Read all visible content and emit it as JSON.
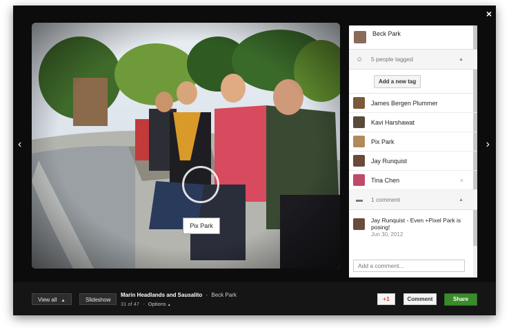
{
  "window": {
    "close_glyph": "×"
  },
  "nav": {
    "prev_glyph": "‹",
    "next_glyph": "›"
  },
  "photo": {
    "tag_label": "Pix Park"
  },
  "panel": {
    "owner_name": "Beck Park",
    "tagged_header": "5 people tagged",
    "add_tag_label": "Add a new tag",
    "people": [
      {
        "name": "James Bergen Plummer",
        "color": "#7a5a3a"
      },
      {
        "name": "Kavi Harshawat",
        "color": "#5a4a3a"
      },
      {
        "name": "Pix Park",
        "color": "#b08a5a"
      },
      {
        "name": "Jay Runquist",
        "color": "#6a4a3a"
      },
      {
        "name": "Tina Chen",
        "color": "#c04a6a"
      }
    ],
    "remove_glyph": "×",
    "comments_header": "1 comment",
    "comment": {
      "text": "Jay Runquist - Even +Pixel Park is posing!",
      "date": "Jun 30, 2012"
    },
    "comment_placeholder": "Add a comment..."
  },
  "bottom": {
    "view_all_label": "View all",
    "slideshow_label": "Slideshow",
    "album_name": "Marin Headlands and Sausalito",
    "album_sep": "-",
    "album_owner": "Beck Park",
    "photo_position": "31 of 47",
    "options_label": "Options",
    "plus_one_label": "+1",
    "comment_label": "Comment",
    "share_label": "Share"
  },
  "colors": {
    "share_green": "#3a8b2a",
    "plus_red": "#d14836",
    "frame": "#0c0c0c"
  }
}
